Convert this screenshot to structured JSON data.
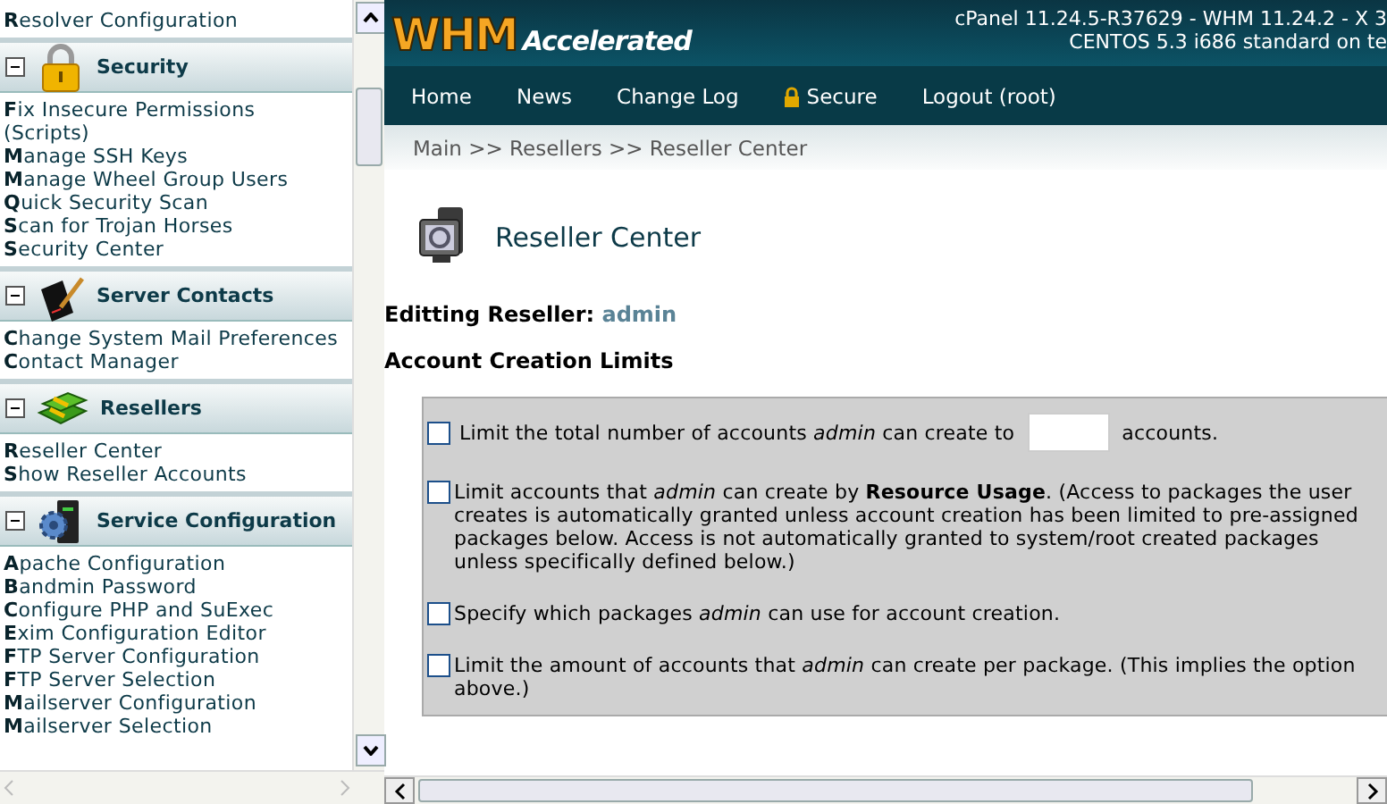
{
  "sidebar": {
    "top_items": [
      "Resolver Configuration"
    ],
    "sections": [
      {
        "title": "Security",
        "expanded": true,
        "items": [
          "Fix Insecure Permissions (Scripts)",
          "Manage SSH Keys",
          "Manage Wheel Group Users",
          "Quick Security Scan",
          "Scan for Trojan Horses",
          "Security Center"
        ]
      },
      {
        "title": "Server Contacts",
        "expanded": true,
        "items": [
          "Change System Mail Preferences",
          "Contact Manager"
        ]
      },
      {
        "title": "Resellers",
        "expanded": true,
        "items": [
          "Reseller Center",
          "Show Reseller Accounts"
        ]
      },
      {
        "title": "Service Configuration",
        "expanded": true,
        "items": [
          "Apache Configuration",
          "Bandmin Password",
          "Configure PHP and SuExec",
          "Exim Configuration Editor",
          "FTP Server Configuration",
          "FTP Server Selection",
          "Mailserver Configuration",
          "Mailserver Selection"
        ]
      }
    ]
  },
  "header": {
    "logo_main": "WHM",
    "logo_sub": "Accelerated",
    "version_lines": [
      "cPanel 11.24.5-R37629 - WHM 11.24.2 - X 3",
      "CENTOS 5.3 i686 standard on te"
    ]
  },
  "nav": [
    {
      "label": "Home"
    },
    {
      "label": "News"
    },
    {
      "label": "Change Log"
    },
    {
      "label": "Secure"
    },
    {
      "label": "Logout (root)"
    }
  ],
  "breadcrumb": "Main >> Resellers >> Reseller Center",
  "page_title": "Reseller Center",
  "editing": {
    "label": "Editting Reseller:",
    "value": "admin"
  },
  "section_title": "Account Creation Limits",
  "options": [
    {
      "kind": "input",
      "checked": false,
      "text": "Limit the total number of accounts *admin* can create to",
      "suffix": "accounts."
    },
    {
      "kind": "plain",
      "checked": false,
      "text": "Limit accounts that *admin* can create by **Resource Usage**. (Access to packages the user creates is automatically granted unless account creation has been limited to pre-assigned packages below. Access is not automatically granted to system/root created packages unless specifically defined below.)"
    },
    {
      "kind": "plain",
      "checked": false,
      "text": "Specify which packages *admin* can use for account creation."
    },
    {
      "kind": "plain",
      "checked": false,
      "text": "Limit the amount of accounts that *admin* can create per package. (This implies the option above.)"
    }
  ]
}
